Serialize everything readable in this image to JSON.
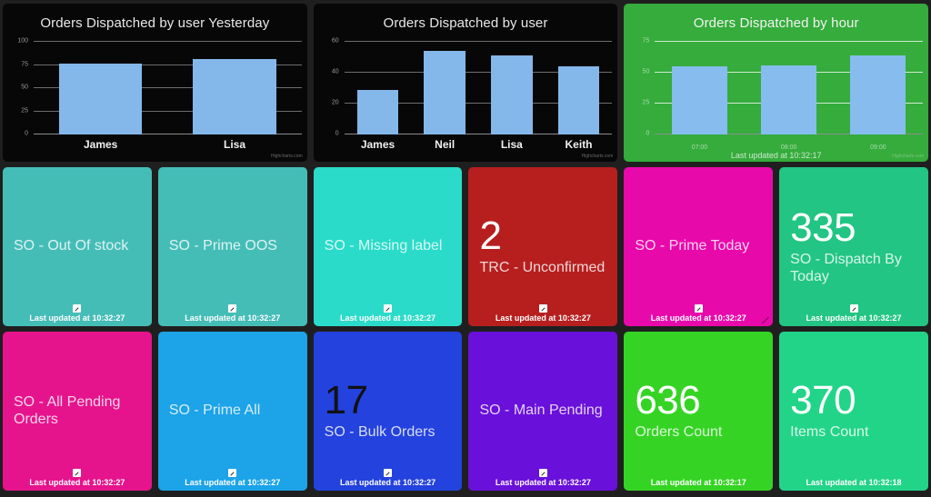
{
  "charts": [
    {
      "title": "Orders Dispatched by user Yesterday",
      "theme": "dark",
      "credits": "Highcharts.com",
      "updated": ""
    },
    {
      "title": "Orders Dispatched by user",
      "theme": "dark",
      "credits": "Highcharts.com",
      "updated": ""
    },
    {
      "title": "Orders Dispatched by hour",
      "theme": "green",
      "credits": "Highcharts.com",
      "updated": "Last updated at 10:32:17"
    }
  ],
  "chart_data": [
    {
      "type": "bar",
      "title": "Orders Dispatched by user Yesterday",
      "categories": [
        "James",
        "Lisa"
      ],
      "values": [
        76,
        81
      ],
      "xlabel": "",
      "ylabel": "",
      "ylim": [
        0,
        100
      ],
      "yticks": [
        0,
        25,
        50,
        75,
        100
      ],
      "grid": true,
      "legend": "none",
      "bar_color": "#84b8ea",
      "background": "#070707"
    },
    {
      "type": "bar",
      "title": "Orders Dispatched by user",
      "categories": [
        "James",
        "Neil",
        "Lisa",
        "Keith"
      ],
      "values": [
        29,
        54,
        51,
        44
      ],
      "xlabel": "",
      "ylabel": "",
      "ylim": [
        0,
        60
      ],
      "yticks": [
        0,
        20,
        40,
        60
      ],
      "grid": true,
      "legend": "none",
      "bar_color": "#84b8ea",
      "background": "#070707"
    },
    {
      "type": "bar",
      "title": "Orders Dispatched by hour",
      "categories": [
        "07:00",
        "08:00",
        "09:00"
      ],
      "values": [
        55,
        56,
        64
      ],
      "xlabel": "",
      "ylabel": "",
      "ylim": [
        0,
        75
      ],
      "yticks": [
        0,
        25,
        50,
        75
      ],
      "grid": true,
      "legend": "none",
      "bar_color": "#86bdee",
      "background": "#35ac3c",
      "annotation": "Last updated at 10:32:17"
    }
  ],
  "tiles_row1": [
    {
      "value": "",
      "label": "SO - Out Of stock",
      "updated": "Last updated at 10:32:27",
      "color": "#45bdb7",
      "has_edit_icon": true,
      "dark_value": false,
      "resize_handle": false
    },
    {
      "value": "",
      "label": "SO - Prime OOS",
      "updated": "Last updated at 10:32:27",
      "color": "#45bdb7",
      "has_edit_icon": true,
      "dark_value": false,
      "resize_handle": false
    },
    {
      "value": "",
      "label": "SO - Missing label",
      "updated": "Last updated at 10:32:27",
      "color": "#2bdbc9",
      "has_edit_icon": true,
      "dark_value": false,
      "resize_handle": false
    },
    {
      "value": "2",
      "label": "TRC - Unconfirmed",
      "updated": "Last updated at 10:32:27",
      "color": "#b71f1f",
      "has_edit_icon": true,
      "dark_value": false,
      "resize_handle": false
    },
    {
      "value": "",
      "label": "SO - Prime Today",
      "updated": "Last updated at 10:32:27",
      "color": "#e809ab",
      "has_edit_icon": true,
      "dark_value": false,
      "resize_handle": true
    },
    {
      "value": "335",
      "label": "SO - Dispatch By Today",
      "updated": "Last updated at 10:32:27",
      "color": "#22c583",
      "has_edit_icon": true,
      "dark_value": false,
      "resize_handle": false
    }
  ],
  "tiles_row2": [
    {
      "value": "",
      "label": "SO - All Pending Orders",
      "updated": "Last updated at 10:32:27",
      "color": "#e6148c",
      "has_edit_icon": true,
      "dark_value": false,
      "resize_handle": false
    },
    {
      "value": "",
      "label": "SO - Prime All",
      "updated": "Last updated at 10:32:27",
      "color": "#1ca3e8",
      "has_edit_icon": true,
      "dark_value": false,
      "resize_handle": false
    },
    {
      "value": "17",
      "label": "SO - Bulk Orders",
      "updated": "Last updated at 10:32:27",
      "color": "#2342de",
      "has_edit_icon": true,
      "dark_value": true,
      "resize_handle": false
    },
    {
      "value": "",
      "label": "SO - Main Pending",
      "updated": "Last updated at 10:32:27",
      "color": "#6910da",
      "has_edit_icon": true,
      "dark_value": false,
      "resize_handle": false
    },
    {
      "value": "636",
      "label": "Orders Count",
      "updated": "Last updated at 10:32:17",
      "color": "#35d424",
      "has_edit_icon": false,
      "dark_value": false,
      "resize_handle": false
    },
    {
      "value": "370",
      "label": "Items Count",
      "updated": "Last updated at 10:32:18",
      "color": "#22d488",
      "has_edit_icon": false,
      "dark_value": false,
      "resize_handle": false
    }
  ]
}
